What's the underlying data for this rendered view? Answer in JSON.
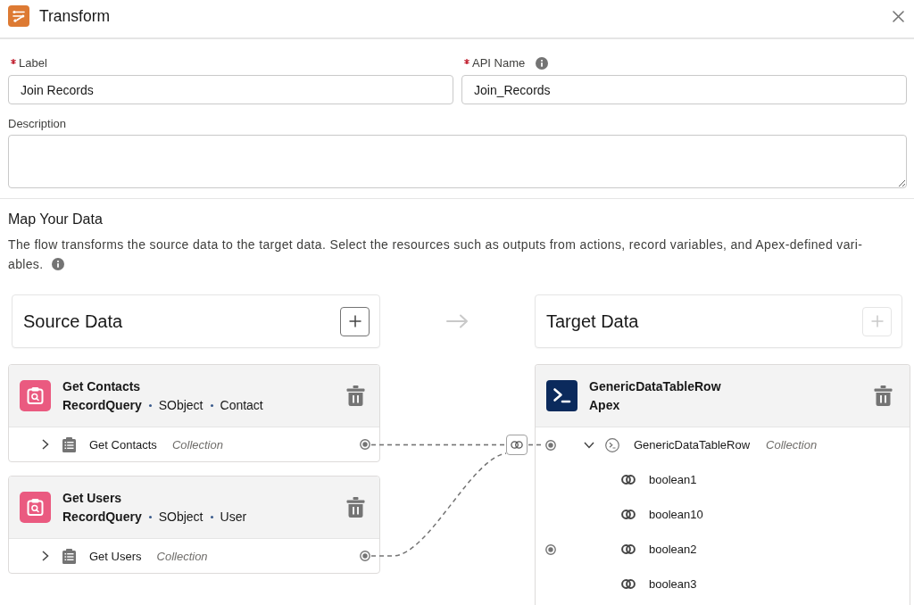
{
  "header": {
    "title": "Transform"
  },
  "fields": [
    {
      "label": "Label",
      "required": true,
      "info": false,
      "value": "Join Records"
    },
    {
      "label": "API Name",
      "required": true,
      "info": true,
      "value": "Join_Records"
    }
  ],
  "description": {
    "label": "Description"
  },
  "mapping": {
    "title": "Map Your Data",
    "text_lines": [
      "The flow transforms the source data to the target data. Select the resources such as outputs from actions, record variables, and Apex-defined vari-",
      "ables."
    ],
    "info": true,
    "source_panel": {
      "title": "Source Data",
      "add_disabled": false
    },
    "target_panel": {
      "title": "Target Data",
      "add_disabled": true
    },
    "sources": [
      {
        "kind": "query",
        "name": "Get Contacts",
        "type": "RecordQuery",
        "meta": [
          "SObject",
          "Contact"
        ],
        "rows": [
          {
            "kind": "records",
            "label": "Get Contacts",
            "tag": "Collection",
            "expanded": false,
            "port": true,
            "linked": true
          }
        ]
      },
      {
        "kind": "query",
        "name": "Get Users",
        "type": "RecordQuery",
        "meta": [
          "SObject",
          "User"
        ],
        "rows": [
          {
            "kind": "records",
            "label": "Get Users",
            "tag": "Collection",
            "expanded": false,
            "port": true,
            "linked": true
          }
        ]
      }
    ],
    "target": {
      "kind": "apex",
      "name": "GenericDataTableRow",
      "type": "Apex",
      "rows": [
        {
          "kind": "apex",
          "label": "GenericDataTableRow",
          "tag": "Collection",
          "expanded": true,
          "port": true,
          "linked": true,
          "children": [
            {
              "kind": "boolean",
              "label": "boolean1",
              "port": false,
              "linked": false
            },
            {
              "kind": "boolean",
              "label": "boolean10",
              "port": false,
              "linked": false
            },
            {
              "kind": "boolean",
              "label": "boolean2",
              "port": true,
              "linked": false
            },
            {
              "kind": "boolean",
              "label": "boolean3",
              "port": false,
              "linked": false
            }
          ]
        }
      ]
    }
  }
}
